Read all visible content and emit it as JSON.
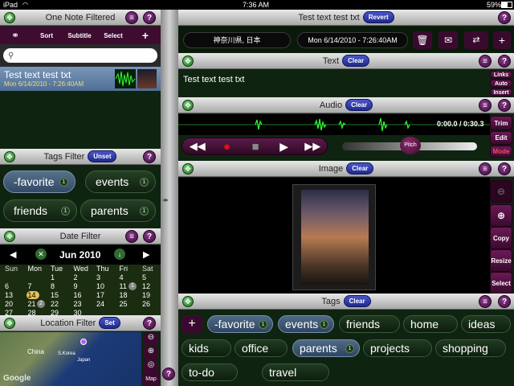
{
  "status": {
    "device": "iPad",
    "time": "7:36 AM",
    "battery": "59%"
  },
  "left": {
    "note_header": {
      "title": "One Note Filtered"
    },
    "toolbar": {
      "sort": "Sort",
      "subtitle": "Subtitle",
      "select": "Select",
      "add": "+"
    },
    "search": {
      "placeholder": ""
    },
    "note": {
      "title": "Test text test txt",
      "date": "Mon 6/14/2010 - 7:26:40AM"
    },
    "tags_filter": {
      "title": "Tags Filter",
      "unset": "Unset",
      "tags": [
        {
          "label": "-favorite",
          "count": "1",
          "selected": true
        },
        {
          "label": "events",
          "count": "1",
          "selected": false
        },
        {
          "label": "friends",
          "count": "1",
          "selected": false
        },
        {
          "label": "parents",
          "count": "1",
          "selected": false
        }
      ]
    },
    "date_filter": {
      "title": "Date Filter",
      "month": "Jun 2010",
      "prev": "◀",
      "next": "▶",
      "days": [
        "Sun",
        "Mon",
        "Tue",
        "Wed",
        "Thu",
        "Fri",
        "Sat"
      ],
      "weeks": [
        [
          "",
          "",
          "1",
          "2",
          "3",
          "4",
          "5"
        ],
        [
          "6",
          "7",
          "8",
          "9",
          "10",
          "11",
          "12"
        ],
        [
          "13",
          "14",
          "15",
          "16",
          "17",
          "18",
          "19"
        ],
        [
          "20",
          "21",
          "22",
          "23",
          "24",
          "25",
          "26"
        ],
        [
          "27",
          "28",
          "29",
          "30",
          "",
          "",
          ""
        ]
      ],
      "today_badge": "2",
      "badge_4": "1"
    },
    "location_filter": {
      "title": "Location Filter",
      "set": "Set",
      "map_labels": {
        "china": "China",
        "korea": "S.Korea",
        "japan": "Japan",
        "google": "Google"
      },
      "map_btn": "Map"
    }
  },
  "right": {
    "header": {
      "title": "Test text test txt",
      "revert": "Revert"
    },
    "location_field": "神奈川県, 日本",
    "date_field": "Mon 6/14/2010 - 7:26:40AM",
    "add": "+",
    "text_section": {
      "title": "Text",
      "clear": "Clear",
      "content": "Test text test txt",
      "links": "Links",
      "auto": "Auto",
      "insert": "Insert"
    },
    "audio_section": {
      "title": "Audio",
      "clear": "Clear",
      "time": "0:00.0 / 0:30.3",
      "trim": "Trim",
      "edit": "Edit",
      "mode": "Mode",
      "pitch": "Pitch"
    },
    "image_section": {
      "title": "Image",
      "clear": "Clear",
      "copy": "Copy",
      "resize": "Resize",
      "select": "Select"
    },
    "tags_section": {
      "title": "Tags",
      "clear": "Clear",
      "add": "+",
      "tags": [
        {
          "label": "-favorite",
          "count": "1",
          "selected": true
        },
        {
          "label": "events",
          "count": "1",
          "selected": true
        },
        {
          "label": "friends",
          "count": "",
          "selected": false
        },
        {
          "label": "home",
          "count": "",
          "selected": false
        },
        {
          "label": "ideas",
          "count": "",
          "selected": false
        },
        {
          "label": "kids",
          "count": "",
          "selected": false
        },
        {
          "label": "office",
          "count": "",
          "selected": false
        },
        {
          "label": "parents",
          "count": "1",
          "selected": true
        },
        {
          "label": "projects",
          "count": "",
          "selected": false
        },
        {
          "label": "shopping",
          "count": "",
          "selected": false
        },
        {
          "label": "to-do",
          "count": "",
          "selected": false
        },
        {
          "label": "travel",
          "count": "",
          "selected": false
        }
      ]
    },
    "help": "?"
  },
  "colors": {
    "accent_purple": "#3e0c30",
    "panel_green": "#0f2410",
    "selected_blue": "#4f6a86",
    "clear_blue": "#2b37a8"
  }
}
